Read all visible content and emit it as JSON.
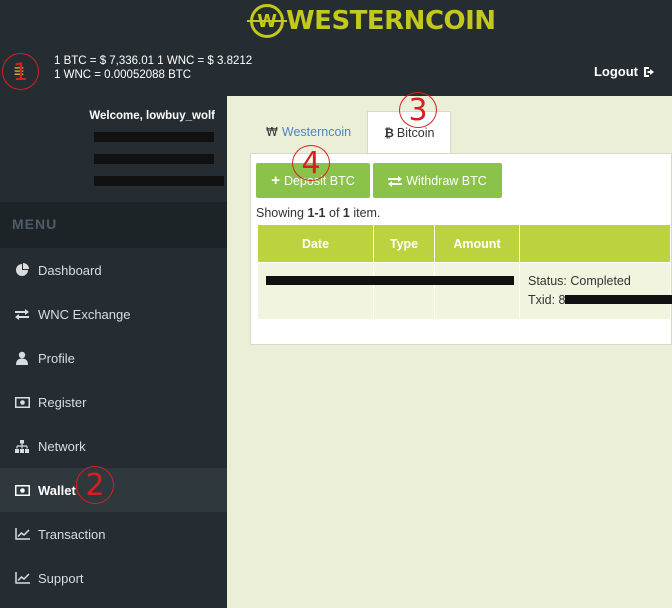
{
  "header": {
    "logo_letter": "W",
    "logo_text": "WESTERNCOIN",
    "rate_line1": "1 BTC = $ 7,336.01   1 WNC = $ 3.8212",
    "rate_line2": "1 WNC = 0.00052088 BTC",
    "logout_label": "Logout"
  },
  "sidebar": {
    "welcome": "Welcome, lowbuy_wolf",
    "menu_heading": "MENU",
    "items": [
      {
        "label": "Dashboard",
        "icon": "pie-chart-icon"
      },
      {
        "label": "WNC Exchange",
        "icon": "exchange-icon"
      },
      {
        "label": "Profile",
        "icon": "user-icon"
      },
      {
        "label": "Register",
        "icon": "money-icon"
      },
      {
        "label": "Network",
        "icon": "sitemap-icon"
      },
      {
        "label": "Wallet",
        "icon": "money-icon",
        "active": true
      },
      {
        "label": "Transaction",
        "icon": "line-chart-icon"
      },
      {
        "label": "Support",
        "icon": "line-chart-icon"
      }
    ]
  },
  "tabs": [
    {
      "label": "Westerncoin",
      "icon": "₩"
    },
    {
      "label": "Bitcoin",
      "icon": "₿",
      "active": true
    }
  ],
  "actions": {
    "deposit_label": "Deposit BTC",
    "withdraw_label": "Withdraw BTC"
  },
  "summary": {
    "prefix": "Showing ",
    "range": "1-1",
    "mid": " of ",
    "total": "1",
    "suffix": " item."
  },
  "table": {
    "headers": [
      "Date",
      "Type",
      "Amount",
      ""
    ],
    "rows": [
      {
        "status": "Status: Completed",
        "txid_prefix": "Txid: 8"
      }
    ]
  },
  "annotations": [
    "1",
    "2",
    "3",
    "4"
  ],
  "colors": {
    "accent": "#8bc34a",
    "logo": "#c3c81c",
    "annotation": "#d62020",
    "header_bg": "#252d32"
  }
}
